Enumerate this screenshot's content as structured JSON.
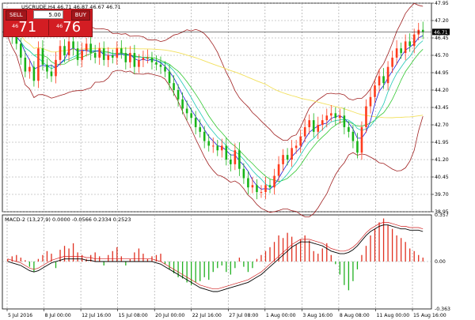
{
  "window": {
    "title": "USCRUDE,H4 46.71 46.87 46.67 46.71"
  },
  "trade_panel": {
    "sell_label": "SELL",
    "buy_label": "BUY",
    "lot_value": "5.00",
    "sell_price_prefix": "46",
    "sell_price_main": "71",
    "buy_price_prefix": "46",
    "buy_price_main": "76"
  },
  "colors": {
    "background": "#ffffff",
    "grid": "#9a9a9a",
    "bull_candle": "#ff3b1d",
    "bear_candle": "#18b418",
    "bollinger": "#a02020",
    "ma_fast": "#1c1cd6",
    "ma_mid": "#1ec8b4",
    "ma_slow": "#32c832",
    "ma_long": "#f2e05c",
    "macd_pos": "#e03020",
    "macd_neg": "#20b020",
    "macd_signal": "#000000",
    "macd_line": "#d02020",
    "price_label_bg": "#000000"
  },
  "price_axis": {
    "labels": [
      "47.95",
      "47.20",
      "46.45",
      "45.70",
      "44.95",
      "44.20",
      "43.45",
      "42.70",
      "41.95",
      "41.20",
      "40.45",
      "39.70",
      "38.95"
    ],
    "current": "46.71"
  },
  "macd_panel": {
    "title": "MACD-2 (13,27,9) 0.0000 -0.0566 0.2334 0.2523",
    "axis_labels": [
      "0.357",
      "0.00",
      "-0.363"
    ]
  },
  "time_axis": {
    "labels": [
      "5 Jul 2016",
      "8 Jul 00:00",
      "12 Jul 16:00",
      "15 Jul 08:00",
      "20 Jul 00:00",
      "22 Jul 16:00",
      "27 Jul 08:00",
      "1 Aug 00:00",
      "3 Aug 16:00",
      "8 Aug 08:00",
      "11 Aug 00:00",
      "15 Aug 16:00"
    ]
  },
  "chart_data": {
    "type": "candlestick",
    "symbol": "USCRUDE",
    "timeframe": "H4",
    "ylim": [
      38.95,
      47.95
    ],
    "closes": [
      46.8,
      46.5,
      46.2,
      45.6,
      45.0,
      45.2,
      44.6,
      46.0,
      45.3,
      45.0,
      44.8,
      45.5,
      46.1,
      45.7,
      46.3,
      46.0,
      45.5,
      45.9,
      46.2,
      45.8,
      45.6,
      46.0,
      45.5,
      45.7,
      45.6,
      46.0,
      45.8,
      45.4,
      45.8,
      45.2,
      45.5,
      45.6,
      45.6,
      45.4,
      45.3,
      45.2,
      45.0,
      44.5,
      44.2,
      43.8,
      43.4,
      43.2,
      43.0,
      42.6,
      42.4,
      42.0,
      41.8,
      41.8,
      41.6,
      41.8,
      41.2,
      41.0,
      41.6,
      40.8,
      40.4,
      40.0,
      40.1,
      39.8,
      39.8,
      40.1,
      40.0,
      40.5,
      41.0,
      41.4,
      41.2,
      41.7,
      41.8,
      42.2,
      42.6,
      42.9,
      42.4,
      42.7,
      42.9,
      43.1,
      43.2,
      43.0,
      43.1,
      42.6,
      42.4,
      42.0,
      41.5,
      42.6,
      43.5,
      43.9,
      44.4,
      44.8,
      44.5,
      45.2,
      45.6,
      46.0,
      45.8,
      46.3,
      46.1,
      46.6,
      46.8,
      46.71
    ],
    "macd_values": [
      0.02,
      0.04,
      0.05,
      0.03,
      0.01,
      -0.04,
      -0.08,
      0.02,
      0.05,
      0.08,
      0.06,
      -0.05,
      0.09,
      0.12,
      0.1,
      0.14,
      0.07,
      0.05,
      0.02,
      0.05,
      0.07,
      0.04,
      -0.03,
      0.05,
      0.08,
      0.11,
      0.04,
      -0.03,
      0.02,
      0.07,
      0.1,
      0.06,
      0.02,
      0.04,
      0.05,
      0.06,
      -0.02,
      -0.06,
      -0.09,
      -0.12,
      -0.13,
      -0.16,
      -0.18,
      -0.16,
      -0.15,
      -0.12,
      -0.14,
      -0.08,
      -0.05,
      -0.03,
      -0.08,
      -0.1,
      -0.05,
      0.03,
      -0.04,
      -0.08,
      -0.05,
      0.02,
      0.05,
      0.08,
      0.11,
      0.15,
      0.2,
      0.18,
      0.22,
      0.19,
      0.13,
      0.17,
      0.2,
      0.16,
      0.08,
      0.06,
      0.1,
      0.14,
      0.05,
      -0.02,
      -0.1,
      -0.18,
      -0.22,
      -0.15,
      -0.06,
      0.05,
      0.12,
      0.2,
      0.25,
      0.3,
      0.33,
      0.28,
      0.25,
      0.2,
      0.18,
      0.15,
      0.1,
      0.08,
      0.05,
      0.03
    ],
    "macd_signal": [
      0.0,
      -0.01,
      -0.02,
      -0.03,
      -0.05,
      -0.07,
      -0.08,
      -0.07,
      -0.05,
      -0.03,
      -0.01,
      0.0,
      0.01,
      0.02,
      0.02,
      0.02,
      0.02,
      0.02,
      0.01,
      0.01,
      0.0,
      0.0,
      0.0,
      0.0,
      0.0,
      0.0,
      0.0,
      0.0,
      0.0,
      0.0,
      0.0,
      0.0,
      0.0,
      0.0,
      -0.01,
      -0.02,
      -0.04,
      -0.06,
      -0.08,
      -0.1,
      -0.12,
      -0.14,
      -0.16,
      -0.18,
      -0.2,
      -0.21,
      -0.22,
      -0.23,
      -0.23,
      -0.22,
      -0.21,
      -0.2,
      -0.19,
      -0.18,
      -0.17,
      -0.16,
      -0.14,
      -0.12,
      -0.1,
      -0.07,
      -0.04,
      -0.01,
      0.02,
      0.05,
      0.08,
      0.11,
      0.13,
      0.15,
      0.15,
      0.15,
      0.14,
      0.13,
      0.12,
      0.1,
      0.08,
      0.07,
      0.06,
      0.06,
      0.07,
      0.09,
      0.12,
      0.16,
      0.2,
      0.23,
      0.25,
      0.27,
      0.28,
      0.28,
      0.27,
      0.26,
      0.25,
      0.25,
      0.24,
      0.24,
      0.24,
      0.23
    ],
    "macd_ylim": [
      -0.363,
      0.357
    ]
  }
}
